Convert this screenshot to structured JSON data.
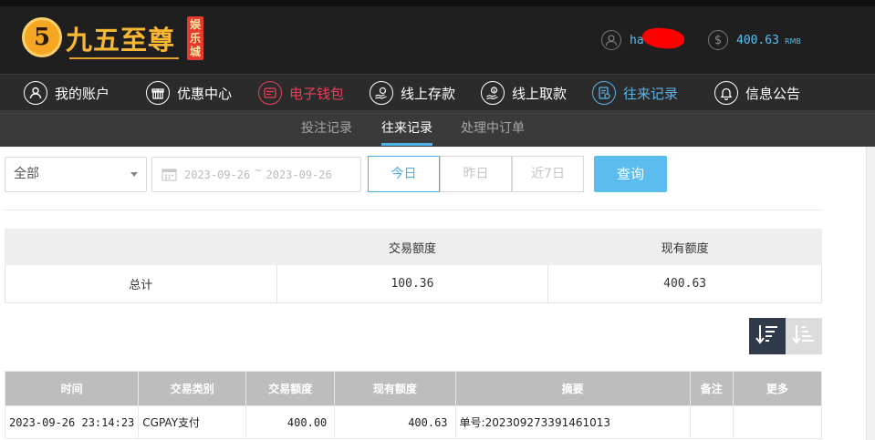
{
  "brand": {
    "logo_mark": "5",
    "name": "九五至尊",
    "badge": "娱乐城"
  },
  "user": {
    "username": "ha",
    "username_redacted": true,
    "balance": "400.63",
    "currency": "RMB"
  },
  "nav": {
    "items": [
      {
        "label": "我的账户",
        "icon": "user-icon"
      },
      {
        "label": "优惠中心",
        "icon": "gift-icon"
      },
      {
        "label": "电子钱包",
        "icon": "wallet-icon"
      },
      {
        "label": "线上存款",
        "icon": "deposit-icon"
      },
      {
        "label": "线上取款",
        "icon": "withdraw-icon"
      },
      {
        "label": "往来记录",
        "icon": "records-icon"
      },
      {
        "label": "信息公告",
        "icon": "bell-icon"
      }
    ],
    "active": "往来记录"
  },
  "subnav": {
    "items": [
      "投注记录",
      "往来记录",
      "处理中订单"
    ],
    "active": "往来记录"
  },
  "filters": {
    "type_select": "全部",
    "date_start": "2023-09-26",
    "date_separator": "~",
    "date_end": "2023-09-26",
    "quick": [
      "今日",
      "昨日",
      "近7日"
    ],
    "quick_active": "今日",
    "query_label": "查询"
  },
  "summary": {
    "headers": [
      "",
      "交易额度",
      "现有额度"
    ],
    "row": [
      "总计",
      "100.36",
      "400.63"
    ]
  },
  "sort": {
    "desc_icon": "sort-desc-icon",
    "asc_icon": "sort-asc-icon"
  },
  "records": {
    "headers": [
      "时间",
      "交易类别",
      "交易额度",
      "现有额度",
      "摘要",
      "备注",
      "更多"
    ],
    "rows": [
      [
        "2023-09-26 23:14:23",
        "CGPAY支付",
        "400.00",
        "400.63",
        "单号:202309273391461013",
        "",
        ""
      ]
    ]
  },
  "colors": {
    "accent_blue": "#5bbcf0",
    "wallet_red": "#e8405a",
    "header_bg": "#1f1f1f",
    "nav_bg": "#2b2b2b",
    "subnav_bg": "#3a3a3a"
  }
}
